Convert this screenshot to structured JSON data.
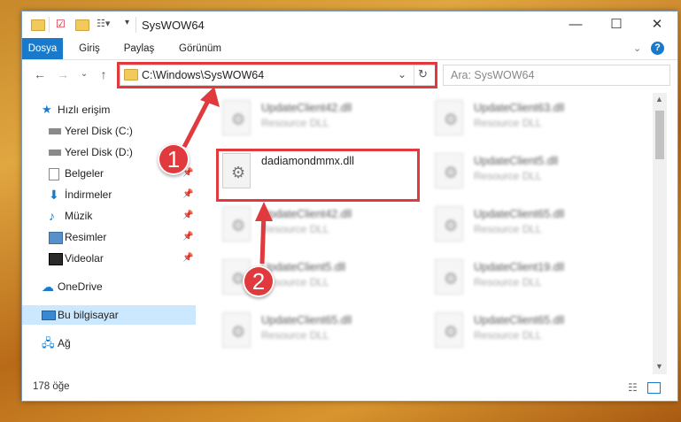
{
  "window": {
    "title": "SysWOW64"
  },
  "ribbon": {
    "tabs": [
      "Dosya",
      "Giriş",
      "Paylaş",
      "Görünüm"
    ],
    "active": "Dosya"
  },
  "address": {
    "path": "C:\\Windows\\SysWOW64",
    "search_placeholder": "Ara: SysWOW64"
  },
  "sidebar": {
    "quick_access": "Hızlı erişim",
    "items": [
      {
        "label": "Yerel Disk (C:)",
        "icon": "drive-icon",
        "pinned": false
      },
      {
        "label": "Yerel Disk (D:)",
        "icon": "drive-icon",
        "pinned": false
      },
      {
        "label": "Belgeler",
        "icon": "documents-icon",
        "pinned": true
      },
      {
        "label": "İndirmeler",
        "icon": "download-icon",
        "pinned": true
      },
      {
        "label": "Müzik",
        "icon": "music-icon",
        "pinned": true
      },
      {
        "label": "Resimler",
        "icon": "pictures-icon",
        "pinned": true
      },
      {
        "label": "Videolar",
        "icon": "videos-icon",
        "pinned": true
      }
    ],
    "onedrive": "OneDrive",
    "this_pc": "Bu bilgisayar",
    "network": "Ağ"
  },
  "files": {
    "left": [
      {
        "name": "UpdateClient42.dll",
        "type": "Resource DLL",
        "blurred": true
      },
      {
        "name": "dadiamondmmx.dll",
        "type": "",
        "blurred": false
      },
      {
        "name": "UpdateClient42.dll",
        "type": "Resource DLL",
        "blurred": true
      },
      {
        "name": "UpdateClient5.dll",
        "type": "Resource DLL",
        "blurred": true
      },
      {
        "name": "UpdateClient65.dll",
        "type": "Resource DLL",
        "blurred": true
      }
    ],
    "right": [
      {
        "name": "UpdateClient63.dll",
        "type": "Resource DLL",
        "blurred": true
      },
      {
        "name": "UpdateClient5.dll",
        "type": "Resource DLL",
        "blurred": true
      },
      {
        "name": "UpdateClient65.dll",
        "type": "Resource DLL",
        "blurred": true
      },
      {
        "name": "UpdateClient19.dll",
        "type": "Resource DLL",
        "blurred": true
      },
      {
        "name": "UpdateClient65.dll",
        "type": "Resource DLL",
        "blurred": true
      }
    ]
  },
  "status": {
    "count": "178 öğe"
  },
  "annotations": {
    "step1": "1",
    "step2": "2",
    "color": "#e0393e"
  }
}
